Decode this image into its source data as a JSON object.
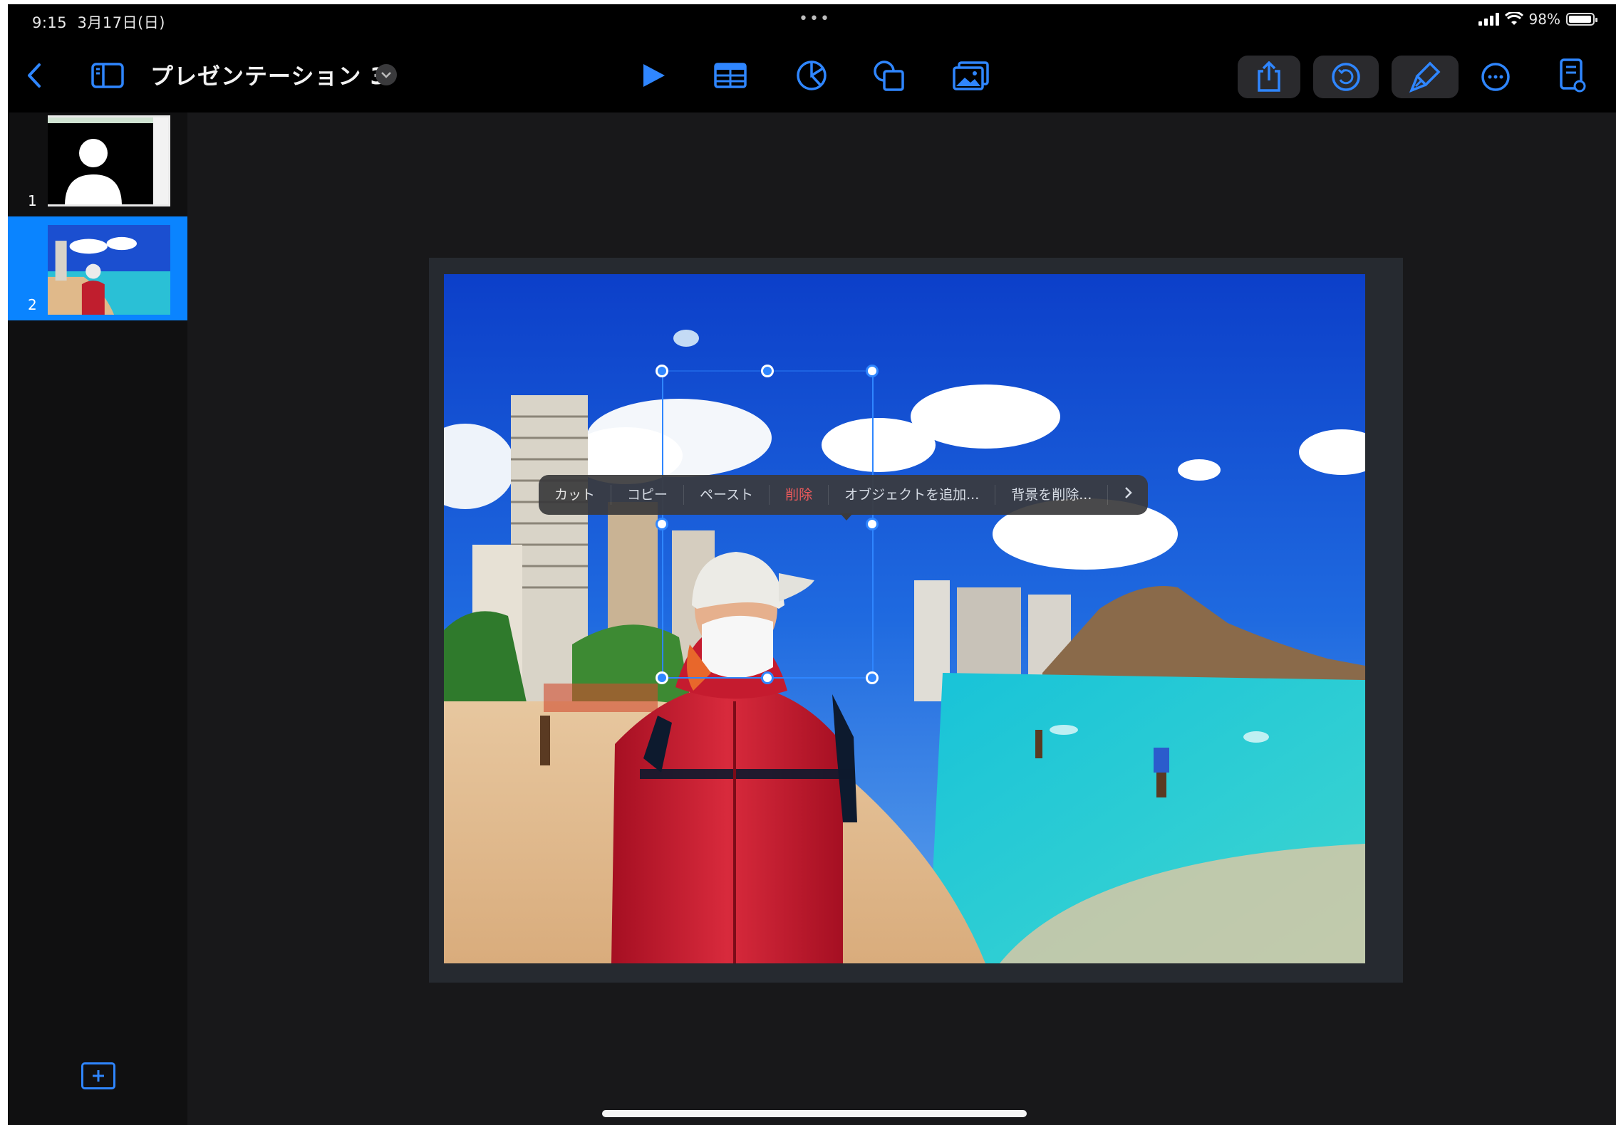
{
  "status_bar": {
    "time": "9:15",
    "date": "3月17日(日)",
    "multitask_dots": "•••",
    "battery_pct": "98%",
    "battery_level": 0.98
  },
  "toolbar": {
    "back_icon": "chevron-left-icon",
    "sidebar_icon": "sidebar-icon",
    "doc_title": "プレゼンテーション 3",
    "center_icons": [
      "play-icon",
      "table-icon",
      "chart-icon",
      "shape-icon",
      "media-icon"
    ],
    "right_icons": [
      "share-icon",
      "undo-icon",
      "format-brush-icon",
      "more-icon",
      "document-icon"
    ],
    "accent": "#2f86ff"
  },
  "navigator": {
    "slides": [
      {
        "number": "1"
      },
      {
        "number": "2",
        "selected": true
      }
    ],
    "add_slide_icon": "add-slide-icon"
  },
  "context_menu": {
    "items": [
      "カット",
      "コピー",
      "ペースト",
      "削除",
      "オブジェクトを追加...",
      "背景を削除..."
    ],
    "more_icon": "chevron-right-icon"
  },
  "colors": {
    "selection_blue": "#0a84ff",
    "background": "#151516"
  }
}
